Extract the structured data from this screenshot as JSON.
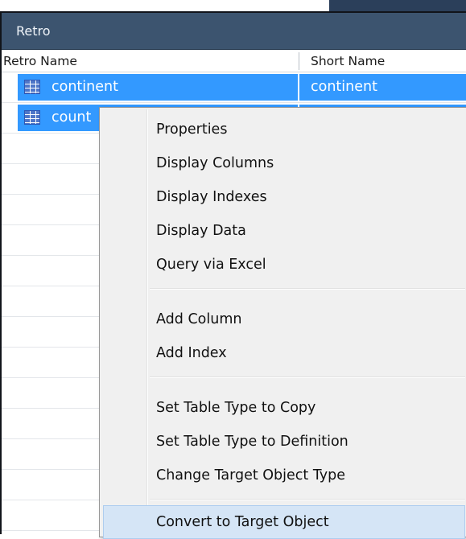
{
  "panel": {
    "title": "Retro"
  },
  "grid": {
    "columns": [
      "Retro Name",
      "Short Name"
    ],
    "rows": [
      {
        "retro_name": "continent",
        "short_name": "continent",
        "selected": true
      },
      {
        "retro_name": "count",
        "short_name": "",
        "selected": true
      }
    ]
  },
  "context_menu": {
    "groups": [
      [
        "Properties",
        "Display Columns",
        "Display Indexes",
        "Display Data",
        "Query via Excel"
      ],
      [
        "Add Column",
        "Add Index"
      ],
      [
        "Set Table Type to Copy",
        "Set Table Type to Definition",
        "Change Target Object Type"
      ],
      [
        "Convert to Target Object"
      ]
    ],
    "highlighted": "Convert to Target Object"
  },
  "icons": {
    "row_icon": "table-icon"
  },
  "colors": {
    "selection": "#3399ff",
    "title_bar": "#3c546f",
    "menu_background": "#f0f0f0",
    "menu_hover": "#d5e5f6"
  }
}
